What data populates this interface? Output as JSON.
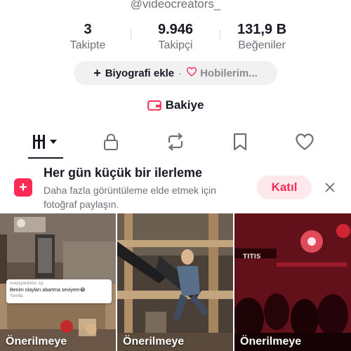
{
  "profile": {
    "username": "@videocreators_"
  },
  "stats": {
    "following": {
      "value": "3",
      "label": "Takipte"
    },
    "followers": {
      "value": "9.946",
      "label": "Takipçi"
    },
    "likes": {
      "value": "131,9 B",
      "label": "Beğeniler"
    }
  },
  "bio": {
    "add_label": "Biyografi ekle",
    "separator": "·",
    "hobbies_label": "Hobilerim..."
  },
  "balance": {
    "label": "Bakiye"
  },
  "tabs": [
    {
      "icon": "grid-icon",
      "selected": true
    },
    {
      "icon": "lock-icon",
      "selected": false
    },
    {
      "icon": "repost-icon",
      "selected": false
    },
    {
      "icon": "bookmark-icon",
      "selected": false
    },
    {
      "icon": "heart-icon",
      "selected": false
    }
  ],
  "banner": {
    "title": "Her gün küçük bir ilerleme",
    "text": "Daha fazla görüntüleme elde etmek için fotoğraf paylaşın.",
    "join_label": "Katıl"
  },
  "videos": [
    {
      "label": "Önerilmeye",
      "comment": {
        "user": "uveyşyardımcı",
        "time": "1g",
        "body": "Benim olayları abartma seviyem😂",
        "reply": "Yanıtla"
      }
    },
    {
      "label": "Önerilmeye"
    },
    {
      "label": "Önerilmeye",
      "overlay_text": "TITIS"
    }
  ],
  "colors": {
    "accent": "#fe2c55",
    "text_primary": "#161823",
    "text_secondary": "#6f7077",
    "pill_bg": "#f1f1f2"
  }
}
